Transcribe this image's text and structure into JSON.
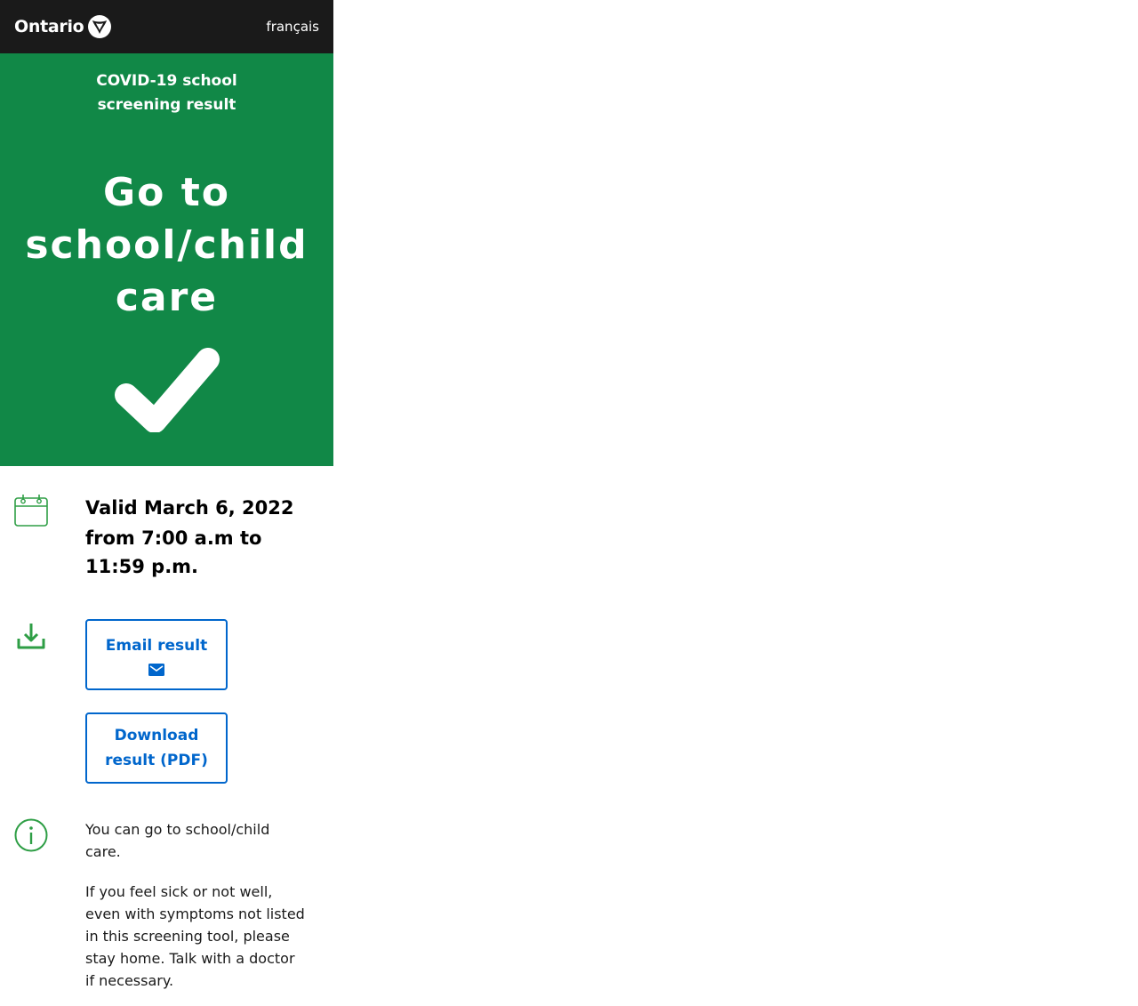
{
  "header": {
    "logo_text": "Ontario",
    "language_link": "français"
  },
  "result": {
    "eyebrow": "COVID-19 school screening result",
    "heading": "Go to school/child care",
    "status_icon": "checkmark-icon",
    "color": "#118847"
  },
  "validity": {
    "icon": "calendar-icon",
    "date_line": "Valid March 6, 2022",
    "time_line": "from 7:00 a.m to 11:59 p.m."
  },
  "actions": {
    "icon": "download-icon",
    "email_label": "Email result",
    "email_icon": "mail-icon",
    "download_label": "Download result (PDF)"
  },
  "info": {
    "icon": "info-icon",
    "line_1": "You can go to school/child care.",
    "line_2": "If you feel sick or not well, even with symptoms not listed in this screening tool, please stay home. Talk with a doctor if necessary."
  },
  "colors": {
    "header_bg": "#1a1a1a",
    "accent_blue": "#0066cc",
    "icon_green": "#2e9e45"
  }
}
